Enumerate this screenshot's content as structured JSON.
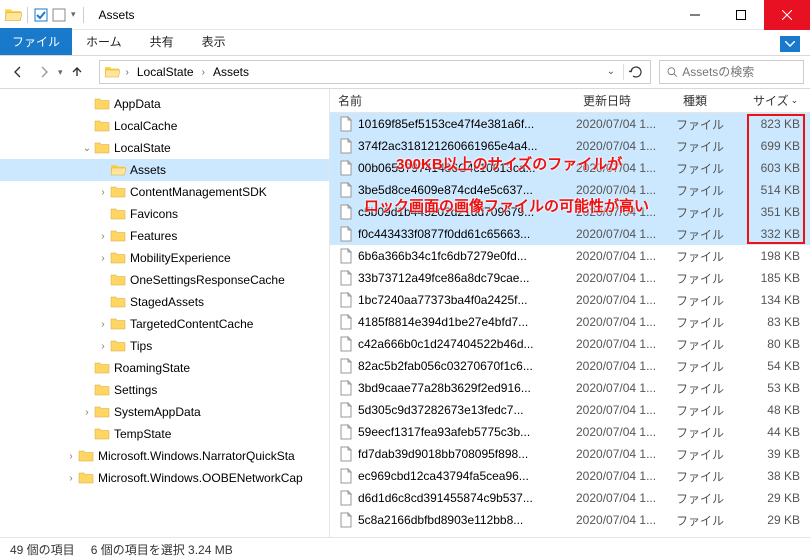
{
  "title": "Assets",
  "ribbon": {
    "file": "ファイル",
    "home": "ホーム",
    "share": "共有",
    "view": "表示"
  },
  "breadcrumbs": [
    "LocalState",
    "Assets"
  ],
  "search_placeholder": "Assetsの検索",
  "columns": {
    "name": "名前",
    "date": "更新日時",
    "type": "種類",
    "size": "サイズ"
  },
  "tree": [
    {
      "label": "AppData",
      "indent": 80,
      "exp": ""
    },
    {
      "label": "LocalCache",
      "indent": 80,
      "exp": ""
    },
    {
      "label": "LocalState",
      "indent": 80,
      "exp": "v"
    },
    {
      "label": "Assets",
      "indent": 96,
      "exp": "",
      "selected": true
    },
    {
      "label": "ContentManagementSDK",
      "indent": 96,
      "exp": ">"
    },
    {
      "label": "Favicons",
      "indent": 96,
      "exp": ""
    },
    {
      "label": "Features",
      "indent": 96,
      "exp": ">"
    },
    {
      "label": "MobilityExperience",
      "indent": 96,
      "exp": ">"
    },
    {
      "label": "OneSettingsResponseCache",
      "indent": 96,
      "exp": ""
    },
    {
      "label": "StagedAssets",
      "indent": 96,
      "exp": ""
    },
    {
      "label": "TargetedContentCache",
      "indent": 96,
      "exp": ">"
    },
    {
      "label": "Tips",
      "indent": 96,
      "exp": ">"
    },
    {
      "label": "RoamingState",
      "indent": 80,
      "exp": ""
    },
    {
      "label": "Settings",
      "indent": 80,
      "exp": ""
    },
    {
      "label": "SystemAppData",
      "indent": 80,
      "exp": ">"
    },
    {
      "label": "TempState",
      "indent": 80,
      "exp": ""
    },
    {
      "label": "Microsoft.Windows.NarratorQuickSta",
      "indent": 64,
      "exp": ">"
    },
    {
      "label": "Microsoft.Windows.OOBENetworkCap",
      "indent": 64,
      "exp": ">"
    }
  ],
  "files": [
    {
      "name": "10169f85ef5153ce47f4e381a6f...",
      "date": "2020/07/04 1...",
      "type": "ファイル",
      "size": "823 KB",
      "selected": true
    },
    {
      "name": "374f2ac318121260661965e4a4...",
      "date": "2020/07/04 1...",
      "type": "ファイル",
      "size": "699 KB",
      "selected": true
    },
    {
      "name": "00b065379741436C4c10613ca...",
      "date": "2020/07/04 1...",
      "type": "ファイル",
      "size": "603 KB",
      "selected": true
    },
    {
      "name": "3be5d8ce4609e874cd4e5c637...",
      "date": "2020/07/04 1...",
      "type": "ファイル",
      "size": "514 KB",
      "selected": true
    },
    {
      "name": "c5b09d1b445202d21dd709679...",
      "date": "2020/07/04 1...",
      "type": "ファイル",
      "size": "351 KB",
      "selected": true
    },
    {
      "name": "f0c443433f0877f0dd61c65663...",
      "date": "2020/07/04 1...",
      "type": "ファイル",
      "size": "332 KB",
      "selected": true
    },
    {
      "name": "6b6a366b34c1fc6db7279e0fd...",
      "date": "2020/07/04 1...",
      "type": "ファイル",
      "size": "198 KB"
    },
    {
      "name": "33b73712a49fce86a8dc79cae...",
      "date": "2020/07/04 1...",
      "type": "ファイル",
      "size": "185 KB"
    },
    {
      "name": "1bc7240aa77373ba4f0a2425f...",
      "date": "2020/07/04 1...",
      "type": "ファイル",
      "size": "134 KB"
    },
    {
      "name": "4185f8814e394d1be27e4bfd7...",
      "date": "2020/07/04 1...",
      "type": "ファイル",
      "size": "83 KB"
    },
    {
      "name": "c42a666b0c1d247404522b46d...",
      "date": "2020/07/04 1...",
      "type": "ファイル",
      "size": "80 KB"
    },
    {
      "name": "82ac5b2fab056c03270670f1c6...",
      "date": "2020/07/04 1...",
      "type": "ファイル",
      "size": "54 KB"
    },
    {
      "name": "3bd9caae77a28b3629f2ed916...",
      "date": "2020/07/04 1...",
      "type": "ファイル",
      "size": "53 KB"
    },
    {
      "name": "5d305c9d37282673e13fedc7...",
      "date": "2020/07/04 1...",
      "type": "ファイル",
      "size": "48 KB"
    },
    {
      "name": "59eecf1317fea93afeb5775c3b...",
      "date": "2020/07/04 1...",
      "type": "ファイル",
      "size": "44 KB"
    },
    {
      "name": "fd7dab39d9018bb708095f898...",
      "date": "2020/07/04 1...",
      "type": "ファイル",
      "size": "39 KB"
    },
    {
      "name": "ec969cbd12ca43794fa5cea96...",
      "date": "2020/07/04 1...",
      "type": "ファイル",
      "size": "38 KB"
    },
    {
      "name": "d6d1d6c8cd391455874c9b537...",
      "date": "2020/07/04 1...",
      "type": "ファイル",
      "size": "29 KB"
    },
    {
      "name": "5c8a2166dbfbd8903e112bb8...",
      "date": "2020/07/04 1...",
      "type": "ファイル",
      "size": "29 KB"
    }
  ],
  "annotations": {
    "line1": "300KB以上のサイズのファイルが",
    "line2": "ロック画面の画像ファイルの可能性が高い"
  },
  "status": {
    "count": "49 個の項目",
    "selected": "6 個の項目を選択 3.24 MB"
  }
}
